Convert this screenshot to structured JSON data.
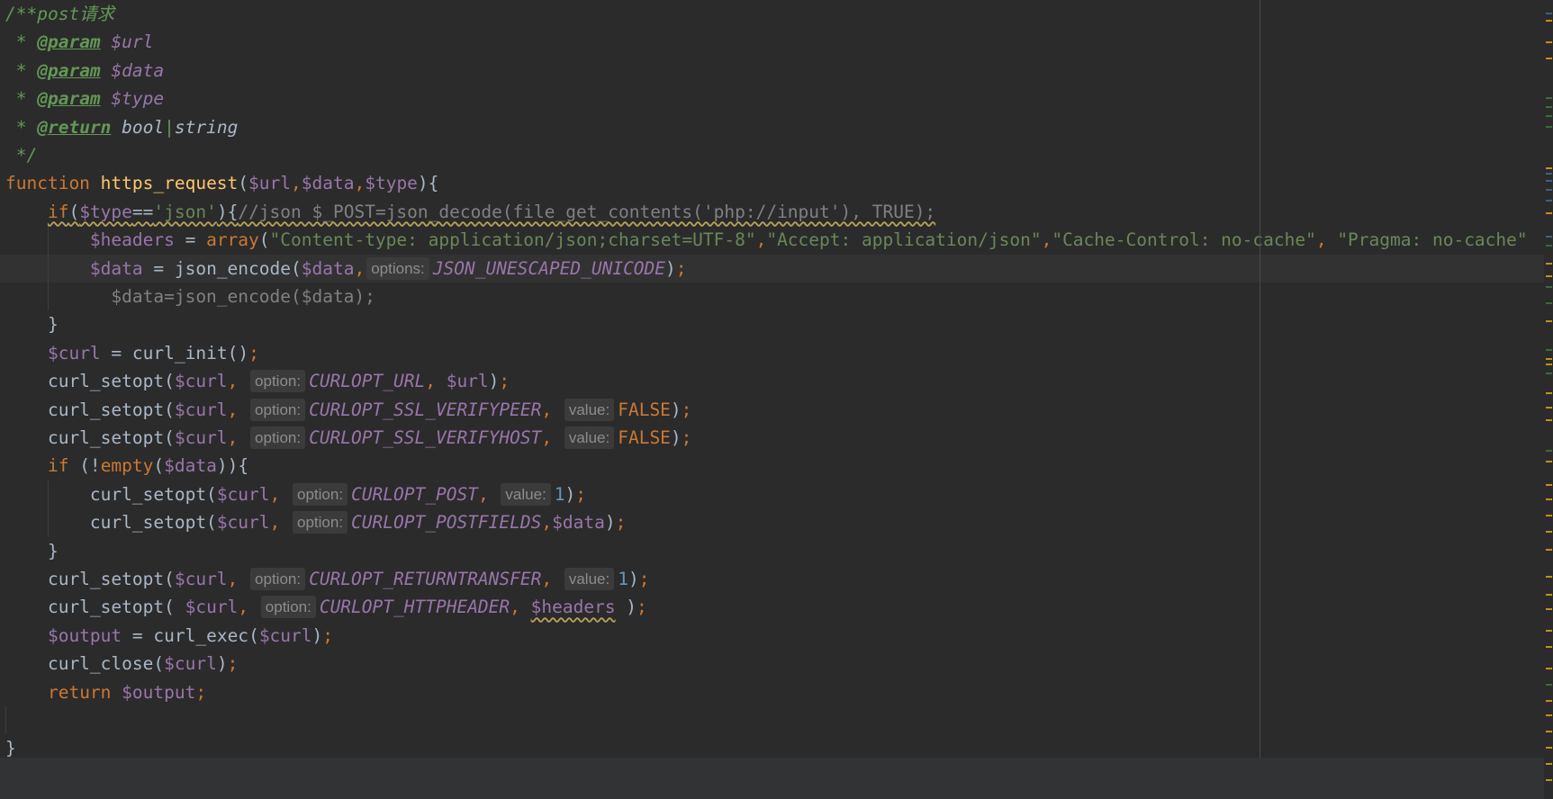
{
  "editor": {
    "lines": [
      [
        {
          "t": "/**post请求",
          "c": "doc"
        }
      ],
      [
        {
          "t": " * ",
          "c": "doc"
        },
        {
          "t": "@param",
          "c": "doctag"
        },
        {
          "t": " ",
          "c": "doc"
        },
        {
          "t": "$url",
          "c": "docvar"
        }
      ],
      [
        {
          "t": " * ",
          "c": "doc"
        },
        {
          "t": "@param",
          "c": "doctag"
        },
        {
          "t": " ",
          "c": "doc"
        },
        {
          "t": "$data",
          "c": "docvar"
        }
      ],
      [
        {
          "t": " * ",
          "c": "doc"
        },
        {
          "t": "@param",
          "c": "doctag"
        },
        {
          "t": " ",
          "c": "doc"
        },
        {
          "t": "$type",
          "c": "docvar"
        }
      ],
      [
        {
          "t": " * ",
          "c": "doc"
        },
        {
          "t": "@return",
          "c": "doctag"
        },
        {
          "t": " ",
          "c": "doc"
        },
        {
          "t": "bool",
          "c": "doctype"
        },
        {
          "t": "|",
          "c": "doc"
        },
        {
          "t": "string",
          "c": "doctype"
        }
      ],
      [
        {
          "t": " */",
          "c": "doc"
        }
      ],
      [
        {
          "t": "function ",
          "c": "kw"
        },
        {
          "t": "https_request",
          "c": "fn"
        },
        {
          "t": "(",
          "c": "plain"
        },
        {
          "t": "$url",
          "c": "var"
        },
        {
          "t": ",",
          "c": "punct"
        },
        {
          "t": "$data",
          "c": "var"
        },
        {
          "t": ",",
          "c": "punct"
        },
        {
          "t": "$type",
          "c": "var"
        },
        {
          "t": "){",
          "c": "plain"
        }
      ],
      [
        {
          "t": "    ",
          "c": "plain"
        },
        {
          "t": "if",
          "c": "kw",
          "w": 1
        },
        {
          "t": "(",
          "c": "plain",
          "w": 1
        },
        {
          "t": "$type",
          "c": "var",
          "w": 1
        },
        {
          "t": "==",
          "c": "plain",
          "w": 1
        },
        {
          "t": "'json'",
          "c": "str",
          "w": 1
        },
        {
          "t": "){",
          "c": "plain",
          "w": 1
        },
        {
          "t": "//json $_POST=json_decode(file_get_contents('php://input'), TRUE);",
          "c": "comment",
          "w": 1
        }
      ],
      [
        {
          "t": "        ",
          "c": "plain"
        },
        {
          "t": "$headers",
          "c": "var"
        },
        {
          "t": " = ",
          "c": "plain"
        },
        {
          "t": "array",
          "c": "kw"
        },
        {
          "t": "(",
          "c": "plain"
        },
        {
          "t": "\"Content-type: application/json;charset=UTF-8\"",
          "c": "str"
        },
        {
          "t": ",",
          "c": "punct"
        },
        {
          "t": "\"Accept: application/json\"",
          "c": "str"
        },
        {
          "t": ",",
          "c": "punct"
        },
        {
          "t": "\"Cache-Control: no-cache\"",
          "c": "str"
        },
        {
          "t": ", ",
          "c": "punct"
        },
        {
          "t": "\"Pragma: no-cache\"",
          "c": "str"
        }
      ],
      [
        {
          "t": "        ",
          "c": "plain"
        },
        {
          "t": "$data",
          "c": "var"
        },
        {
          "t": " = ",
          "c": "plain"
        },
        {
          "t": "json_encode",
          "c": "plain"
        },
        {
          "t": "(",
          "c": "plain"
        },
        {
          "t": "$data",
          "c": "var"
        },
        {
          "t": ",",
          "c": "punct"
        },
        {
          "h": "options:"
        },
        {
          "t": "JSON_UNESCAPED_UNICODE",
          "c": "const"
        },
        {
          "t": ")",
          "c": "plain"
        },
        {
          "t": ";",
          "c": "punct"
        }
      ],
      [
        {
          "t": "          $data=json_encode($data);",
          "c": "comment"
        }
      ],
      [
        {
          "t": "    }",
          "c": "plain"
        }
      ],
      [
        {
          "t": "    ",
          "c": "plain"
        },
        {
          "t": "$curl",
          "c": "var"
        },
        {
          "t": " = ",
          "c": "plain"
        },
        {
          "t": "curl_init",
          "c": "plain"
        },
        {
          "t": "()",
          "c": "plain"
        },
        {
          "t": ";",
          "c": "punct"
        }
      ],
      [
        {
          "t": "    curl_setopt(",
          "c": "plain"
        },
        {
          "t": "$curl",
          "c": "var"
        },
        {
          "t": ", ",
          "c": "punct"
        },
        {
          "h": "option:"
        },
        {
          "t": "CURLOPT_URL",
          "c": "const"
        },
        {
          "t": ", ",
          "c": "punct"
        },
        {
          "t": "$url",
          "c": "var"
        },
        {
          "t": ")",
          "c": "plain"
        },
        {
          "t": ";",
          "c": "punct"
        }
      ],
      [
        {
          "t": "    curl_setopt(",
          "c": "plain"
        },
        {
          "t": "$curl",
          "c": "var"
        },
        {
          "t": ", ",
          "c": "punct"
        },
        {
          "h": "option:"
        },
        {
          "t": "CURLOPT_SSL_VERIFYPEER",
          "c": "const"
        },
        {
          "t": ", ",
          "c": "punct"
        },
        {
          "h": "value:"
        },
        {
          "t": "FALSE",
          "c": "kw"
        },
        {
          "t": ")",
          "c": "plain"
        },
        {
          "t": ";",
          "c": "punct"
        }
      ],
      [
        {
          "t": "    curl_setopt(",
          "c": "plain"
        },
        {
          "t": "$curl",
          "c": "var"
        },
        {
          "t": ", ",
          "c": "punct"
        },
        {
          "h": "option:"
        },
        {
          "t": "CURLOPT_SSL_VERIFYHOST",
          "c": "const"
        },
        {
          "t": ", ",
          "c": "punct"
        },
        {
          "h": "value:"
        },
        {
          "t": "FALSE",
          "c": "kw"
        },
        {
          "t": ")",
          "c": "plain"
        },
        {
          "t": ";",
          "c": "punct"
        }
      ],
      [
        {
          "t": "    ",
          "c": "plain"
        },
        {
          "t": "if",
          "c": "kw"
        },
        {
          "t": " (!",
          "c": "plain"
        },
        {
          "t": "empty",
          "c": "kw"
        },
        {
          "t": "(",
          "c": "plain"
        },
        {
          "t": "$data",
          "c": "var"
        },
        {
          "t": ")){",
          "c": "plain"
        }
      ],
      [
        {
          "t": "        curl_setopt(",
          "c": "plain"
        },
        {
          "t": "$curl",
          "c": "var"
        },
        {
          "t": ", ",
          "c": "punct"
        },
        {
          "h": "option:"
        },
        {
          "t": "CURLOPT_POST",
          "c": "const"
        },
        {
          "t": ", ",
          "c": "punct"
        },
        {
          "h": "value:"
        },
        {
          "t": "1",
          "c": "num"
        },
        {
          "t": ")",
          "c": "plain"
        },
        {
          "t": ";",
          "c": "punct"
        }
      ],
      [
        {
          "t": "        curl_setopt(",
          "c": "plain"
        },
        {
          "t": "$curl",
          "c": "var"
        },
        {
          "t": ", ",
          "c": "punct"
        },
        {
          "h": "option:"
        },
        {
          "t": "CURLOPT_POSTFIELDS",
          "c": "const"
        },
        {
          "t": ",",
          "c": "punct"
        },
        {
          "t": "$data",
          "c": "var"
        },
        {
          "t": ")",
          "c": "plain"
        },
        {
          "t": ";",
          "c": "punct"
        }
      ],
      [
        {
          "t": "    }",
          "c": "plain"
        }
      ],
      [
        {
          "t": "    curl_setopt(",
          "c": "plain"
        },
        {
          "t": "$curl",
          "c": "var"
        },
        {
          "t": ", ",
          "c": "punct"
        },
        {
          "h": "option:"
        },
        {
          "t": "CURLOPT_RETURNTRANSFER",
          "c": "const"
        },
        {
          "t": ", ",
          "c": "punct"
        },
        {
          "h": "value:"
        },
        {
          "t": "1",
          "c": "num"
        },
        {
          "t": ")",
          "c": "plain"
        },
        {
          "t": ";",
          "c": "punct"
        }
      ],
      [
        {
          "t": "    curl_setopt( ",
          "c": "plain"
        },
        {
          "t": "$curl",
          "c": "var"
        },
        {
          "t": ", ",
          "c": "punct"
        },
        {
          "h": "option:"
        },
        {
          "t": "CURLOPT_HTTPHEADER",
          "c": "const"
        },
        {
          "t": ", ",
          "c": "punct"
        },
        {
          "t": "$headers",
          "c": "var",
          "w": 1
        },
        {
          "t": " )",
          "c": "plain"
        },
        {
          "t": ";",
          "c": "punct"
        }
      ],
      [
        {
          "t": "    ",
          "c": "plain"
        },
        {
          "t": "$output",
          "c": "var"
        },
        {
          "t": " = ",
          "c": "plain"
        },
        {
          "t": "curl_exec",
          "c": "plain"
        },
        {
          "t": "(",
          "c": "plain"
        },
        {
          "t": "$curl",
          "c": "var"
        },
        {
          "t": ")",
          "c": "plain"
        },
        {
          "t": ";",
          "c": "punct"
        }
      ],
      [
        {
          "t": "    curl_close(",
          "c": "plain"
        },
        {
          "t": "$curl",
          "c": "var"
        },
        {
          "t": ")",
          "c": "plain"
        },
        {
          "t": ";",
          "c": "punct"
        }
      ],
      [
        {
          "t": "    ",
          "c": "plain"
        },
        {
          "t": "return ",
          "c": "kw"
        },
        {
          "t": "$output",
          "c": "var"
        },
        {
          "t": ";",
          "c": "punct"
        }
      ],
      [],
      [
        {
          "t": "}",
          "c": "plain"
        }
      ]
    ],
    "current_line": 9
  },
  "colors": {
    "background": "#2b2b2b",
    "keyword": "#cc7832",
    "function": "#ffc66d",
    "variable": "#9876aa",
    "string": "#6a8759",
    "number": "#6897bb",
    "comment": "#808080",
    "doc": "#629755",
    "error_stripe_warning": "#be9117",
    "error_stripe_info": "#3d6185",
    "error_stripe_ok": "#3b6b3b"
  }
}
